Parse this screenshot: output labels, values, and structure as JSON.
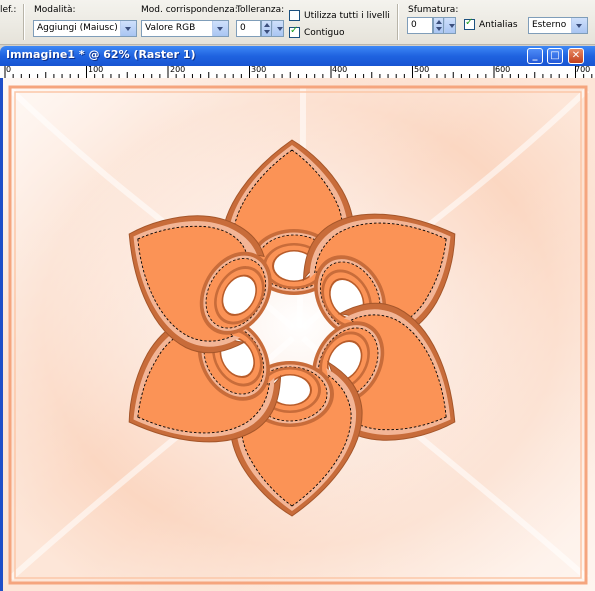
{
  "toolbar": {
    "cut_label": "lef.:",
    "mode": {
      "label": "Modalità:",
      "value": "Aggiungi (Maiusc)"
    },
    "match": {
      "label": "Mod. corrispondenza:",
      "value": "Valore RGB"
    },
    "tolerance": {
      "label": "Tolleranza:",
      "value": "0"
    },
    "all_layers": {
      "label": "Utilizza tutti i livelli",
      "checked": false
    },
    "contiguous": {
      "label": "Contiguo",
      "checked": true
    },
    "feather": {
      "label": "Sfumatura:",
      "value": "0"
    },
    "antialias": {
      "label": "Antialias",
      "checked": true
    },
    "outside": {
      "value": "Esterno"
    }
  },
  "window": {
    "title": "Immagine1 * @ 62% (Raster 1)",
    "buttons": {
      "minimize": "_",
      "maximize": "□",
      "close": "✕"
    }
  },
  "ruler": {
    "labels": [
      "0",
      "100",
      "200",
      "300",
      "400",
      "500",
      "600",
      "700"
    ]
  },
  "colors": {
    "petal_fill": "#fb9356",
    "petal_stroke": "#b85c2a",
    "background_tint": "#fbd2b9",
    "frame": "#f5a57e"
  }
}
